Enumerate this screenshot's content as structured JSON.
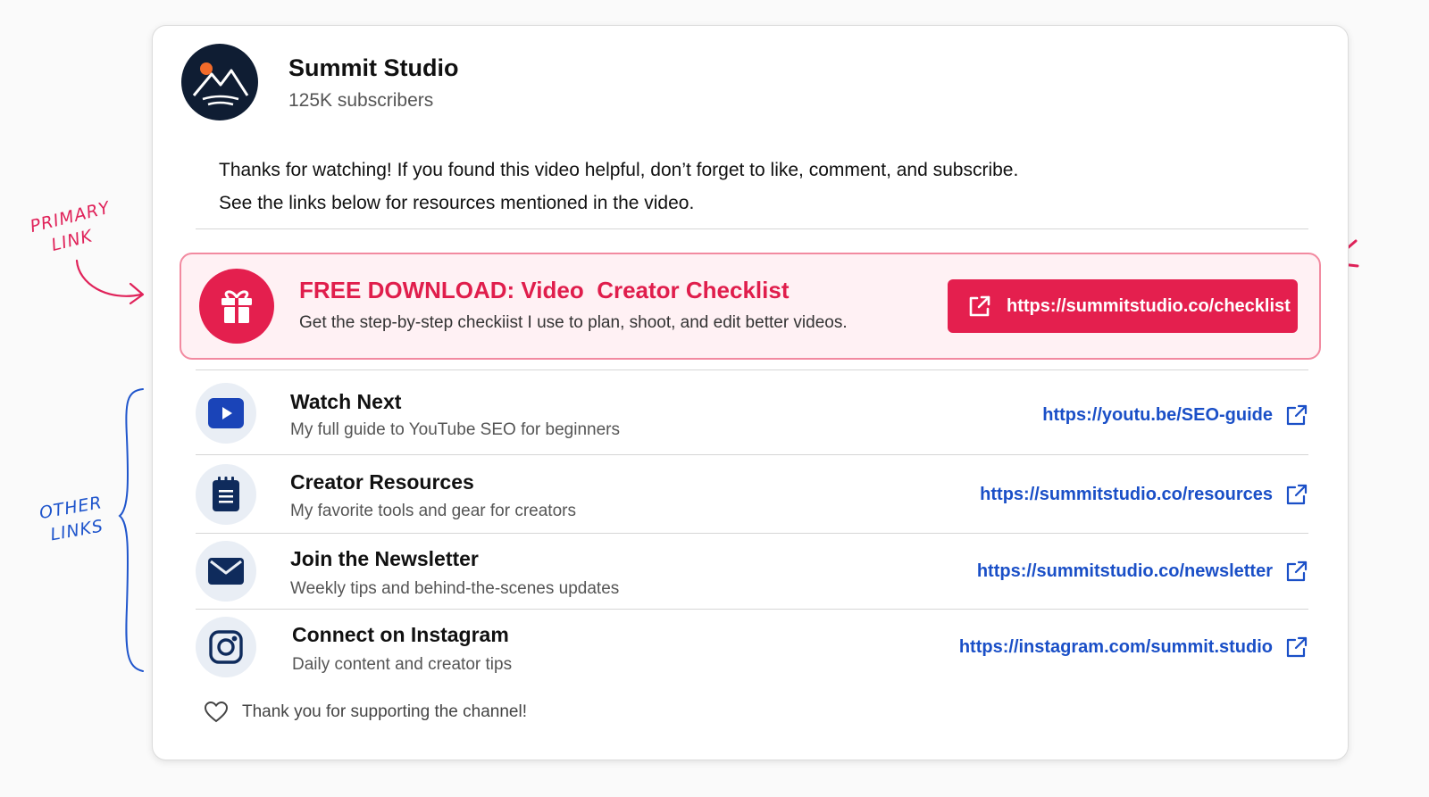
{
  "channel": {
    "name": "Summit Studio",
    "subscribers": "125K subscribers"
  },
  "description": {
    "line1": "Thanks for watching! If you found this video helpful, don’t forget to like, comment, and subscribe.",
    "line2": "See the links below for resources mentioned in the video."
  },
  "primary_link": {
    "title": "FREE DOWNLOAD: Video  Creator Checklist",
    "subtitle": "Get the step-by-step checkiist I use to plan, shoot, and edit better videos.",
    "url": "https://summitstudio.co/checklist",
    "icon": "gift-icon",
    "accent_color": "#e41f4e"
  },
  "links": [
    {
      "title": "Watch Next",
      "subtitle": "My full guide to YouTube SEO for beginners",
      "url": "https://youtu.be/SEO-guide",
      "icon": "play-icon"
    },
    {
      "title": "Creator Resources",
      "subtitle": "My favorite tools and gear for creators",
      "url": "https://summitstudio.co/resources",
      "icon": "notepad-icon"
    },
    {
      "title": "Join the Newsletter",
      "subtitle": "Weekly tips and behind-the-scenes updates",
      "url": "https://summitstudio.co/newsletter",
      "icon": "mail-icon"
    },
    {
      "title": "Connect on Instagram",
      "subtitle": "Daily content and creator tips",
      "url": "https://instagram.com/summit.studio",
      "icon": "instagram-icon"
    }
  ],
  "footer": {
    "text": "Thank you for supporting the channel!",
    "icon": "heart-icon"
  },
  "annotations": {
    "primary": [
      "PRIMARY",
      "LINK"
    ],
    "other": [
      "OTHER",
      "LINKS"
    ]
  },
  "colors": {
    "link_blue": "#1a4fc7",
    "icon_navy": "#0f2b5c",
    "annotation_red": "#e0235a",
    "annotation_blue": "#1f55cc"
  }
}
